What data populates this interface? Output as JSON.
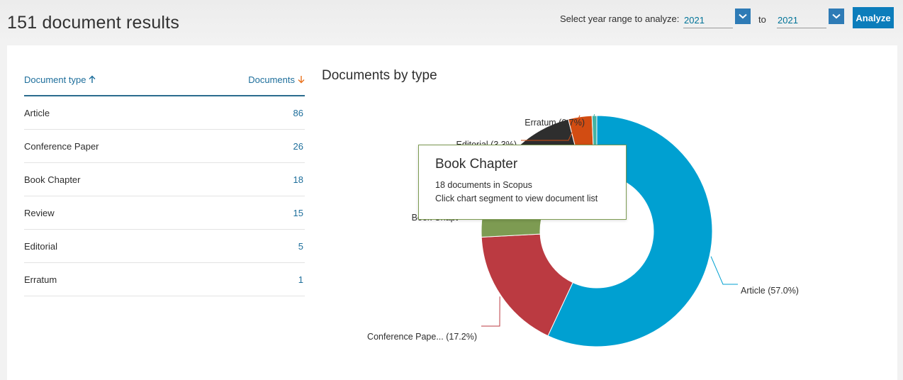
{
  "header": {
    "results_title": "151 document results",
    "year_range_label": "Select year range to analyze:",
    "from_year": "2021",
    "to_label": "to",
    "to_year": "2021",
    "analyze_label": "Analyze"
  },
  "table": {
    "col_type": "Document type",
    "col_count": "Documents",
    "rows": [
      {
        "type": "Article",
        "count": "86"
      },
      {
        "type": "Conference Paper",
        "count": "26"
      },
      {
        "type": "Book Chapter",
        "count": "18"
      },
      {
        "type": "Review",
        "count": "15"
      },
      {
        "type": "Editorial",
        "count": "5"
      },
      {
        "type": "Erratum",
        "count": "1"
      }
    ]
  },
  "chart_data": {
    "type": "pie",
    "title": "Documents by type",
    "donut": true,
    "categories": [
      "Article",
      "Conference Paper",
      "Book Chapter",
      "Review",
      "Editorial",
      "Erratum"
    ],
    "values": [
      86,
      26,
      18,
      15,
      5,
      1
    ],
    "colors": [
      "#00a0d1",
      "#bb3a41",
      "#7d9b52",
      "#2e2e2e",
      "#d24c12",
      "#44b3a4"
    ],
    "labels": [
      "Article (57.0%)",
      "Conference Pape... (17.2%)",
      "Book Chapt",
      "",
      "Editorial (3.3%)",
      "Erratum (0.7%)"
    ]
  },
  "tooltip": {
    "title": "Book Chapter",
    "line1": "18 documents in Scopus",
    "line2": "Click chart segment to view document list"
  },
  "icons": {
    "sort_up": "arrow-up-icon",
    "sort_down": "arrow-down-icon",
    "caret": "chevron-down-icon"
  },
  "colors": {
    "accent": "#0c7dbb",
    "link": "#1d6e9b",
    "sort_down": "#e9711c"
  }
}
